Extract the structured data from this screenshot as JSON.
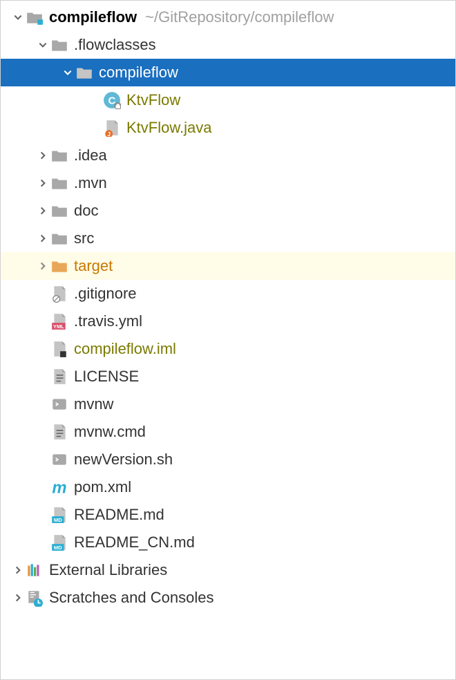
{
  "tree": {
    "root": {
      "name": "compileflow",
      "path": "~/GitRepository/compileflow"
    },
    "items": [
      {
        "label": ".flowclasses",
        "type": "folder"
      },
      {
        "label": "compileflow",
        "type": "folder-selected"
      },
      {
        "label": "KtvFlow",
        "type": "class"
      },
      {
        "label": "KtvFlow.java",
        "type": "java"
      },
      {
        "label": ".idea",
        "type": "folder"
      },
      {
        "label": ".mvn",
        "type": "folder"
      },
      {
        "label": "doc",
        "type": "folder"
      },
      {
        "label": "src",
        "type": "folder"
      },
      {
        "label": "target",
        "type": "folder-target"
      },
      {
        "label": ".gitignore",
        "type": "file-ignore"
      },
      {
        "label": ".travis.yml",
        "type": "file-yml"
      },
      {
        "label": "compileflow.iml",
        "type": "file-iml"
      },
      {
        "label": "LICENSE",
        "type": "file-text"
      },
      {
        "label": "mvnw",
        "type": "file-sh"
      },
      {
        "label": "mvnw.cmd",
        "type": "file-text"
      },
      {
        "label": "newVersion.sh",
        "type": "file-sh"
      },
      {
        "label": "pom.xml",
        "type": "file-maven"
      },
      {
        "label": "README.md",
        "type": "file-md"
      },
      {
        "label": "README_CN.md",
        "type": "file-md"
      },
      {
        "label": "External Libraries",
        "type": "libraries"
      },
      {
        "label": "Scratches and Consoles",
        "type": "scratches"
      }
    ]
  }
}
